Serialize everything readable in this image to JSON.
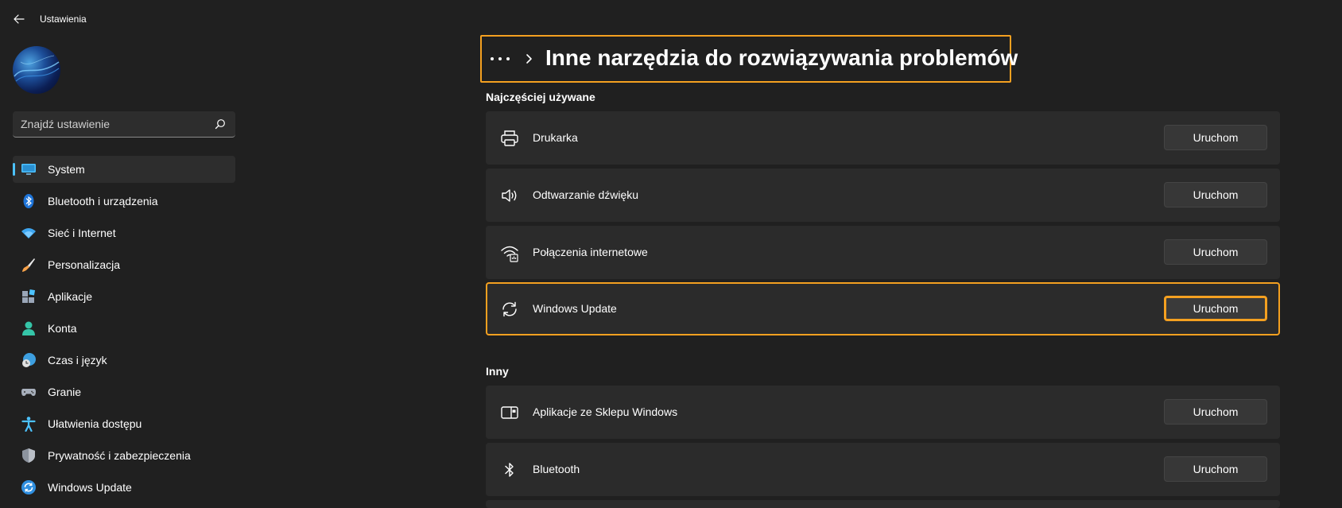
{
  "app": {
    "title": "Ustawienia"
  },
  "search": {
    "placeholder": "Znajdź ustawienie"
  },
  "sidebar": {
    "items": [
      {
        "label": "System",
        "icon": "monitor-icon",
        "active": true
      },
      {
        "label": "Bluetooth i urządzenia",
        "icon": "bluetooth-icon"
      },
      {
        "label": "Sieć i Internet",
        "icon": "wifi-icon"
      },
      {
        "label": "Personalizacja",
        "icon": "brush-icon"
      },
      {
        "label": "Aplikacje",
        "icon": "apps-icon"
      },
      {
        "label": "Konta",
        "icon": "person-icon"
      },
      {
        "label": "Czas i język",
        "icon": "globe-clock-icon"
      },
      {
        "label": "Granie",
        "icon": "gamepad-icon"
      },
      {
        "label": "Ułatwienia dostępu",
        "icon": "accessibility-icon"
      },
      {
        "label": "Prywatność i zabezpieczenia",
        "icon": "shield-icon"
      },
      {
        "label": "Windows Update",
        "icon": "update-icon"
      }
    ]
  },
  "header": {
    "title": "Inne narzędzia do rozwiązywania problemów"
  },
  "sections": [
    {
      "title": "Najczęściej używane",
      "items": [
        {
          "label": "Drukarka",
          "icon": "printer-icon",
          "button": "Uruchom"
        },
        {
          "label": "Odtwarzanie dźwięku",
          "icon": "speaker-icon",
          "button": "Uruchom"
        },
        {
          "label": "Połączenia internetowe",
          "icon": "network-icon",
          "button": "Uruchom"
        },
        {
          "label": "Windows Update",
          "icon": "sync-icon",
          "button": "Uruchom",
          "highlighted": true
        }
      ]
    },
    {
      "title": "Inny",
      "items": [
        {
          "label": "Aplikacje ze Sklepu Windows",
          "icon": "store-app-icon",
          "button": "Uruchom"
        },
        {
          "label": "Bluetooth",
          "icon": "bluetooth-icon",
          "button": "Uruchom"
        }
      ]
    }
  ],
  "colors": {
    "background": "#202020",
    "card": "#2b2b2b",
    "accent": "#4cc2ff",
    "highlight": "#f4a020"
  }
}
